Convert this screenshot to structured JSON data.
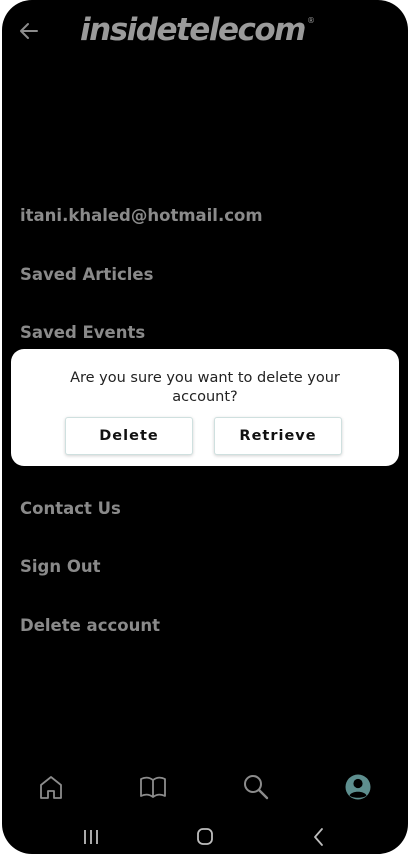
{
  "header": {
    "logo_text": "insidetelecom",
    "logo_reg_mark": "®",
    "back_icon": "arrow-left-icon"
  },
  "menu": {
    "email": "itani.khaled@hotmail.com",
    "saved_articles": "Saved Articles",
    "saved_events": "Saved Events",
    "contact_us": "Contact Us",
    "sign_out": "Sign Out",
    "delete_account": "Delete account"
  },
  "dialog": {
    "message": "Are you sure you want to delete your account?",
    "delete_label": "Delete",
    "retrieve_label": "Retrieve"
  },
  "bottom_nav": {
    "items": [
      "home-icon",
      "book-icon",
      "search-icon",
      "profile-icon"
    ],
    "active": "profile-icon"
  },
  "system_nav": [
    "recents-icon",
    "home-circle-icon",
    "back-chevron-icon"
  ],
  "colors": {
    "background": "#000000",
    "menu_text": "#8a8a8a",
    "logo": "#9a9a9a",
    "icon": "#8c8c8c",
    "active_icon": "#5e8f8f",
    "dialog_bg": "#ffffff"
  }
}
